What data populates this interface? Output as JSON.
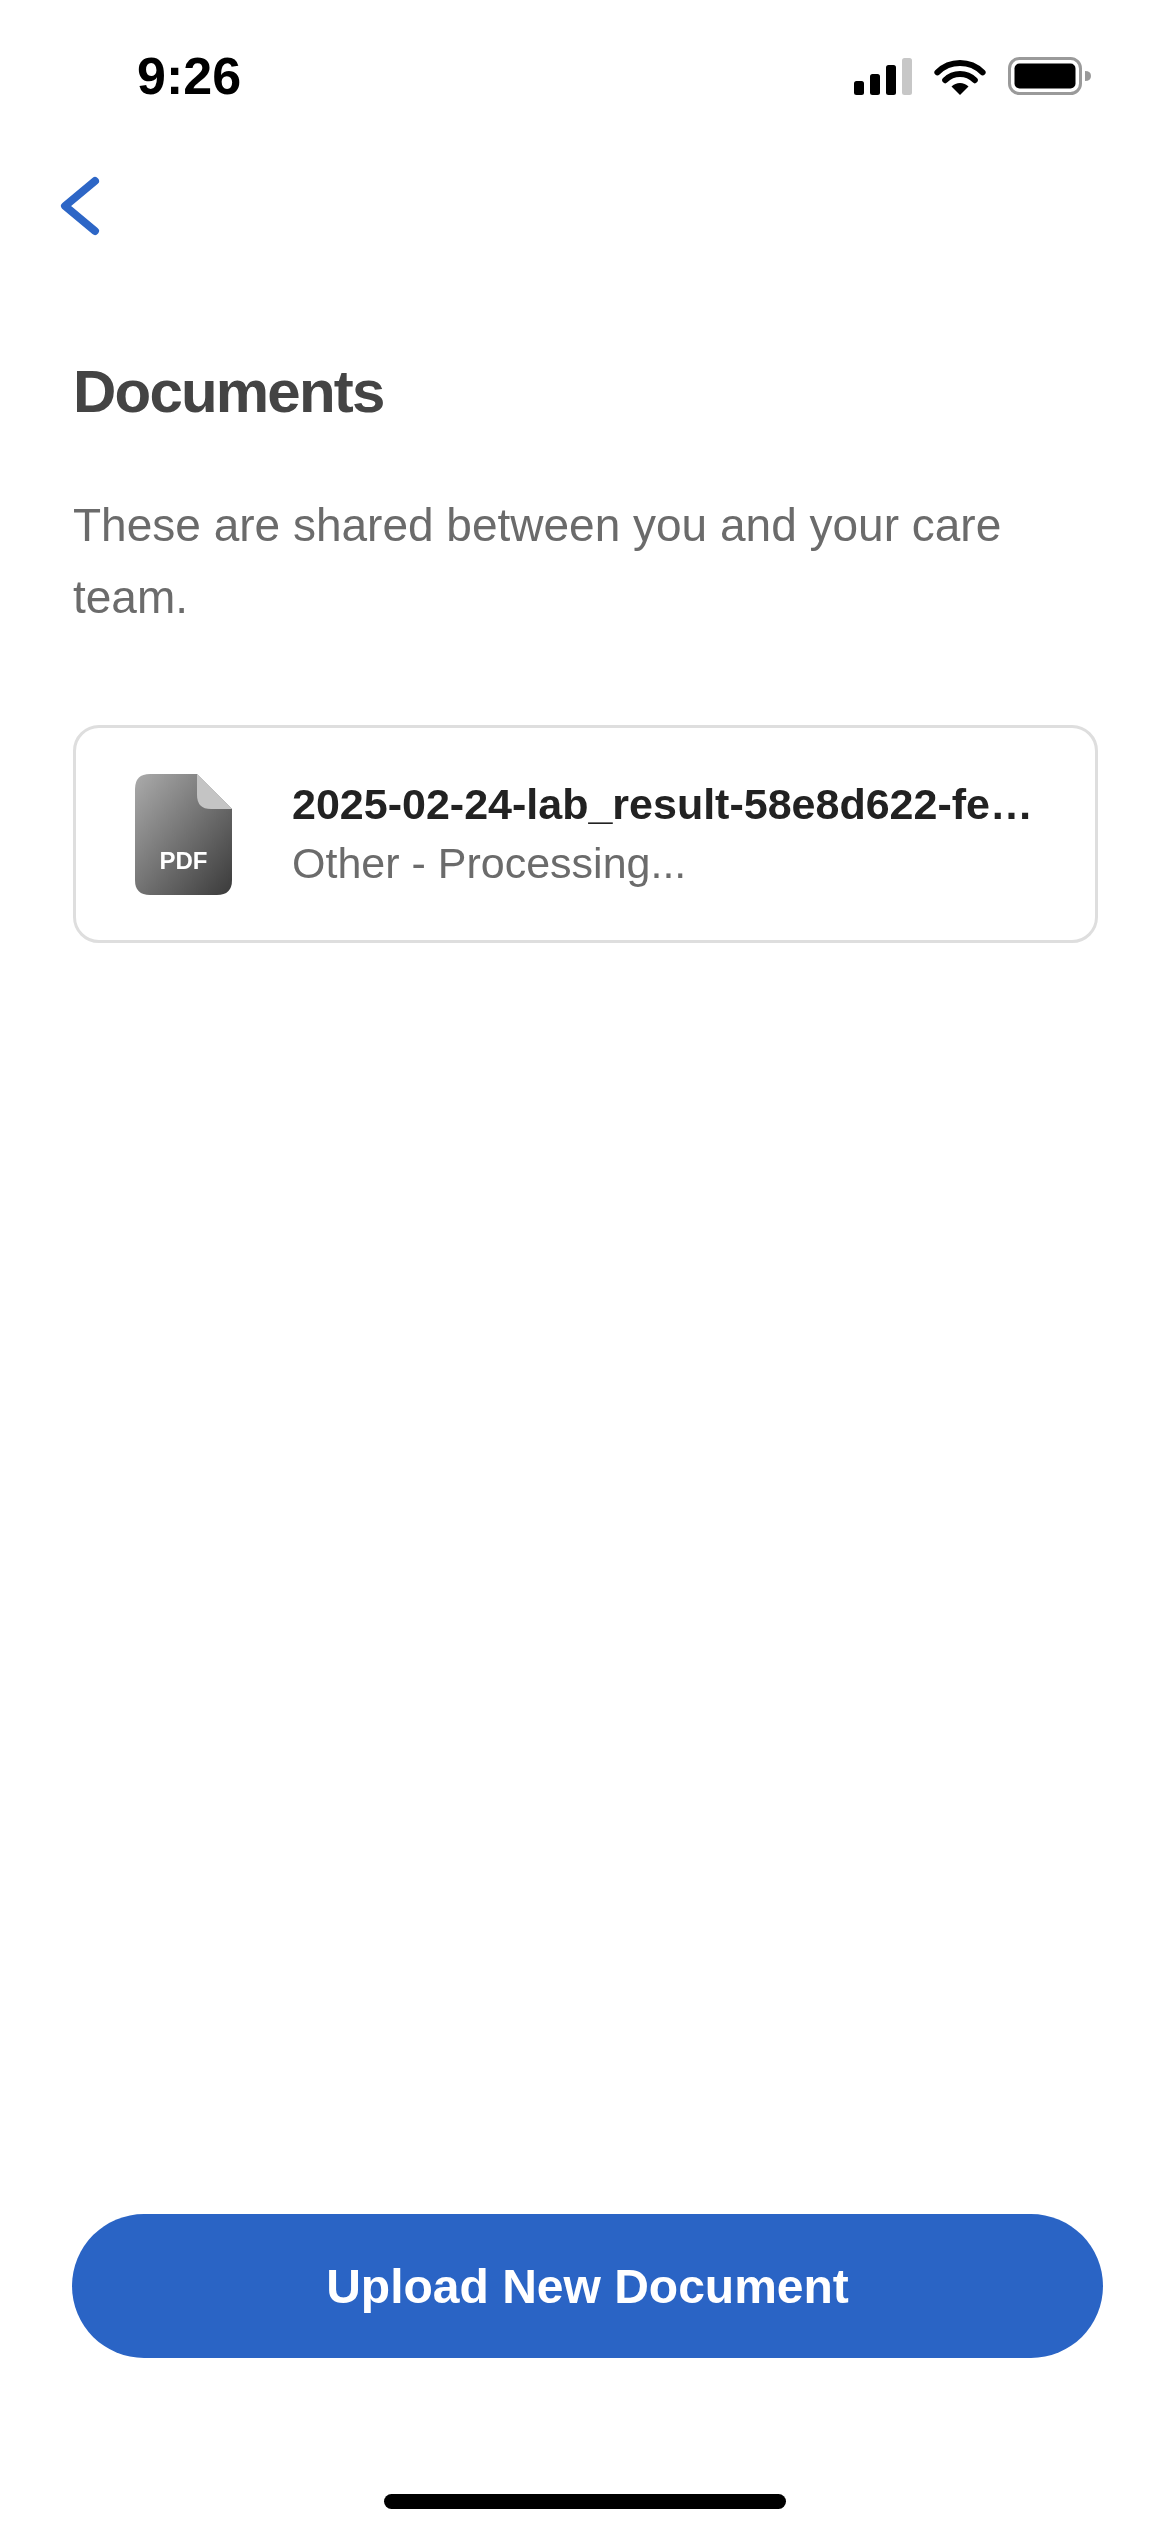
{
  "status_bar": {
    "time": "9:26"
  },
  "header": {
    "title": "Documents",
    "subtitle": "These are shared between you and your care team."
  },
  "documents": [
    {
      "file_type": "PDF",
      "name": "2025-02-24-lab_result-58e8d622-fe…",
      "detail": "Other - Processing..."
    }
  ],
  "upload_button": {
    "label": "Upload New Document"
  }
}
